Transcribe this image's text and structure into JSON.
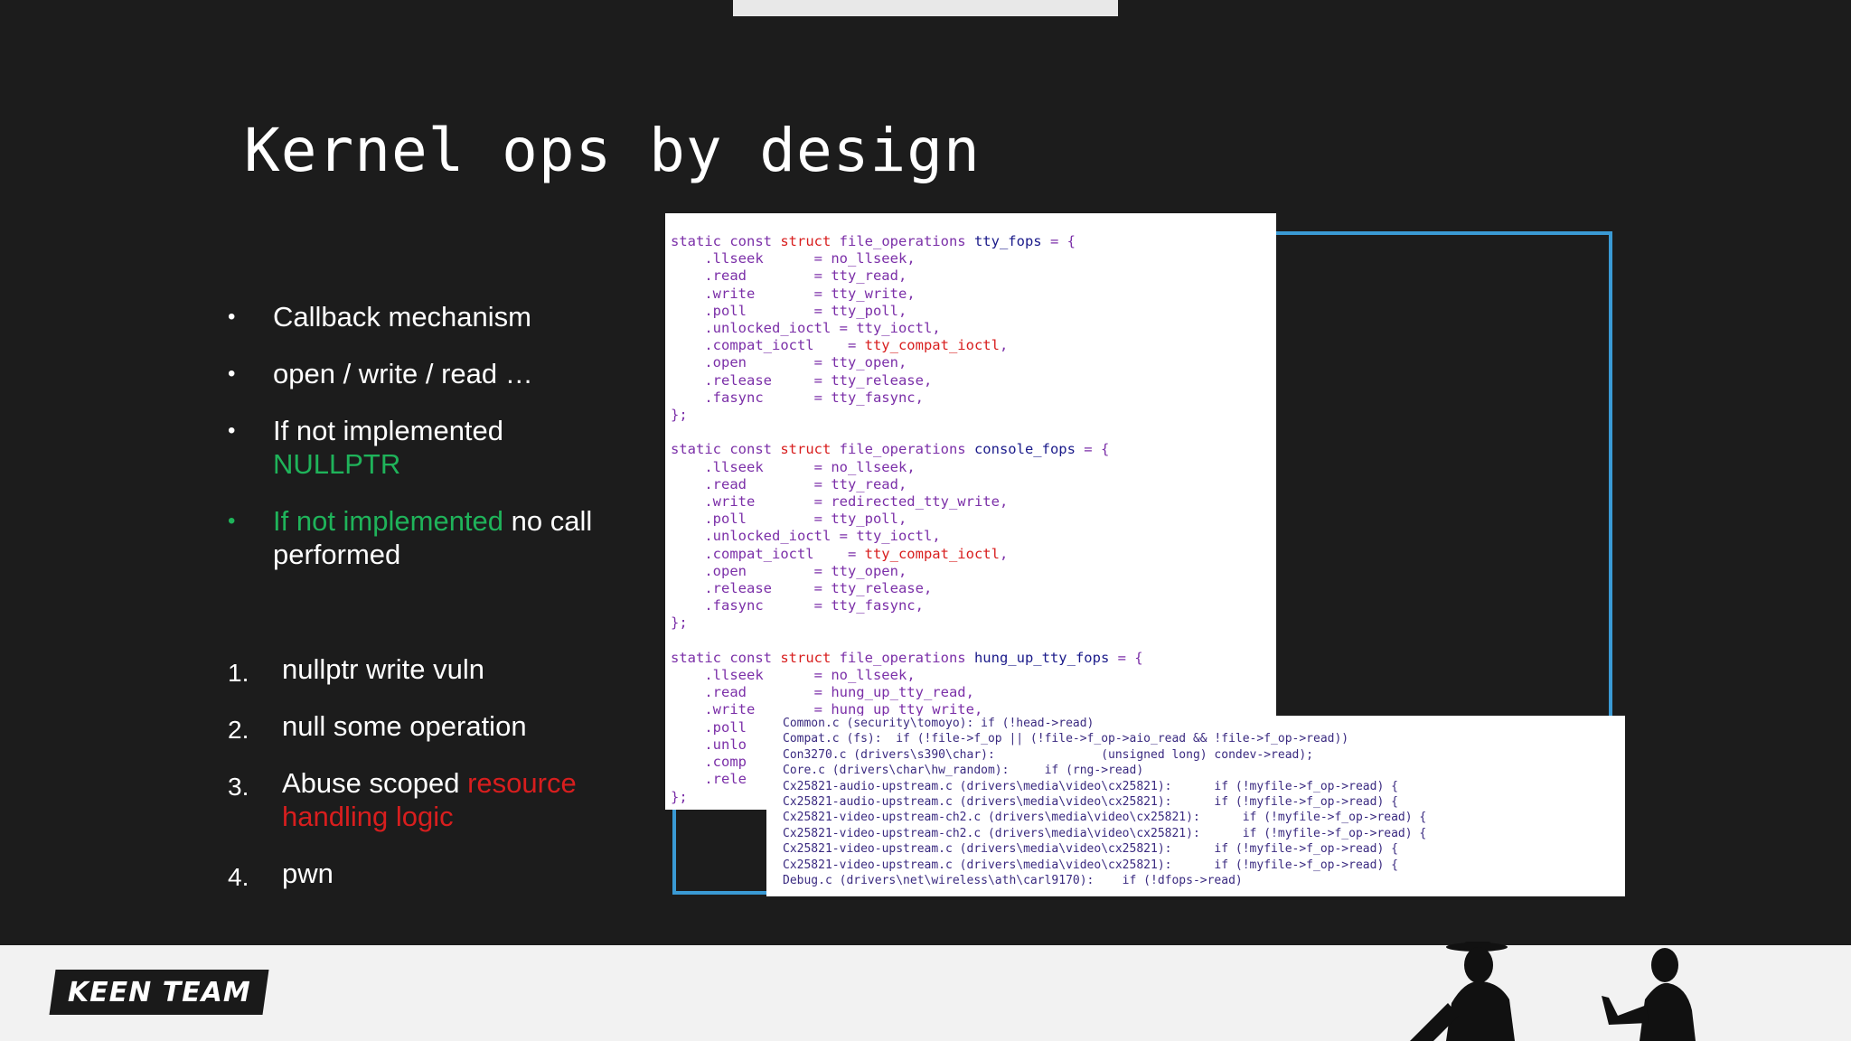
{
  "slide": {
    "title": "Kernel ops by design",
    "bullets": [
      {
        "text": "Callback mechanism"
      },
      {
        "text": "open / write / read …"
      },
      {
        "text_white": "If not implemented",
        "text_green": "NULLPTR"
      },
      {
        "text_green": "If not implemented",
        "text_white": " no call performed"
      }
    ],
    "steps": [
      {
        "num": "1.",
        "text": "nullptr write vuln"
      },
      {
        "num": "2.",
        "text": "null some operation"
      },
      {
        "num": "3.",
        "text": "Abuse scoped ",
        "text_red": "resource handling logic"
      },
      {
        "num": "4.",
        "text": "pwn"
      }
    ]
  },
  "code_main": {
    "structs": [
      {
        "prefix": "static const ",
        "kw": "struct",
        "type": " file_operations ",
        "name": "tty_fops",
        "suffix": " = {",
        "fields": [
          [
            ".llseek      = ",
            "no_llseek",
            ","
          ],
          [
            ".read        = ",
            "tty_read",
            ","
          ],
          [
            ".write       = ",
            "tty_write",
            ","
          ],
          [
            ".poll        = ",
            "tty_poll",
            ","
          ],
          [
            ".unlocked_ioctl = ",
            "tty_ioctl",
            ","
          ],
          [
            ".compat_ioctl    = ",
            "tty_compat_ioctl",
            ",",
            "red"
          ],
          [
            ".open        = ",
            "tty_open",
            ","
          ],
          [
            ".release     = ",
            "tty_release",
            ","
          ],
          [
            ".fasync      = ",
            "tty_fasync",
            ","
          ]
        ],
        "close": "};"
      },
      {
        "prefix": "static const ",
        "kw": "struct",
        "type": " file_operations ",
        "name": "console_fops",
        "suffix": " = {",
        "fields": [
          [
            ".llseek      = ",
            "no_llseek",
            ","
          ],
          [
            ".read        = ",
            "tty_read",
            ","
          ],
          [
            ".write       = ",
            "redirected_tty_write",
            ","
          ],
          [
            ".poll        = ",
            "tty_poll",
            ","
          ],
          [
            ".unlocked_ioctl = ",
            "tty_ioctl",
            ","
          ],
          [
            ".compat_ioctl    = ",
            "tty_compat_ioctl",
            ",",
            "red"
          ],
          [
            ".open        = ",
            "tty_open",
            ","
          ],
          [
            ".release     = ",
            "tty_release",
            ","
          ],
          [
            ".fasync      = ",
            "tty_fasync",
            ","
          ]
        ],
        "close": "};"
      },
      {
        "prefix": "static const ",
        "kw": "struct",
        "type": " file_operations ",
        "name": "hung_up_tty_fops",
        "suffix": " = {",
        "fields": [
          [
            ".llseek      = ",
            "no_llseek",
            ","
          ],
          [
            ".read        = ",
            "hung_up_tty_read",
            ","
          ],
          [
            ".write       = ",
            "hung_up_tty_write",
            ","
          ],
          [
            ".poll",
            "",
            ""
          ],
          [
            ".unlo",
            "",
            ""
          ],
          [
            ".comp",
            "",
            ""
          ],
          [
            ".rele",
            "",
            ""
          ]
        ],
        "close": "};"
      }
    ]
  },
  "code_search": {
    "lines": [
      "Common.c (security\\tomoyo): if (!head->read)",
      "Compat.c (fs):  if (!file->f_op || (!file->f_op->aio_read && !file->f_op->read))",
      "Con3270.c (drivers\\s390\\char):               (unsigned long) condev->read);",
      "Core.c (drivers\\char\\hw_random):     if (rng->read)",
      "Cx25821-audio-upstream.c (drivers\\media\\video\\cx25821):      if (!myfile->f_op->read) {",
      "Cx25821-audio-upstream.c (drivers\\media\\video\\cx25821):      if (!myfile->f_op->read) {",
      "Cx25821-video-upstream-ch2.c (drivers\\media\\video\\cx25821):      if (!myfile->f_op->read) {",
      "Cx25821-video-upstream-ch2.c (drivers\\media\\video\\cx25821):      if (!myfile->f_op->read) {",
      "Cx25821-video-upstream.c (drivers\\media\\video\\cx25821):      if (!myfile->f_op->read) {",
      "Cx25821-video-upstream.c (drivers\\media\\video\\cx25821):      if (!myfile->f_op->read) {",
      "Debug.c (drivers\\net\\wireless\\ath\\carl9170):    if (!dfops->read)"
    ]
  },
  "footer": {
    "logo_text": "KEEN TEAM"
  },
  "colors": {
    "background": "#1c1c1c",
    "green": "#1fb35a",
    "red": "#d81e1e",
    "frame_blue": "#3a9ad4"
  }
}
